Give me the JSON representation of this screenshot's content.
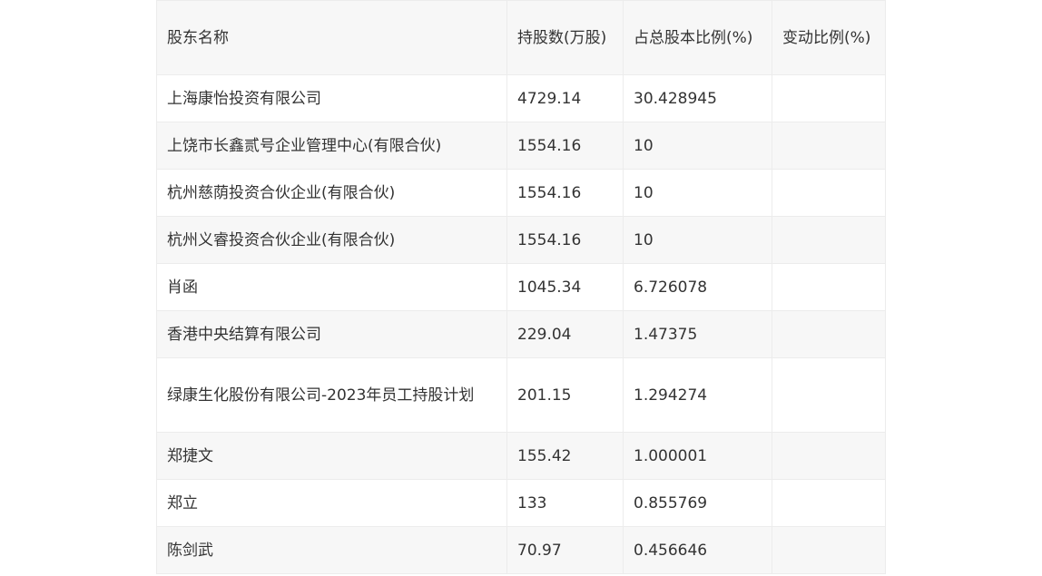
{
  "table": {
    "headers": [
      "股东名称",
      "持股数(万股)",
      "占总股本比例(%)",
      "变动比例(%)"
    ],
    "rows": [
      {
        "name": "上海康怡投资有限公司",
        "shares": "4729.14",
        "ratio": "30.428945",
        "change": ""
      },
      {
        "name": "上饶市长鑫贰号企业管理中心(有限合伙)",
        "shares": "1554.16",
        "ratio": "10",
        "change": ""
      },
      {
        "name": "杭州慈荫投资合伙企业(有限合伙)",
        "shares": "1554.16",
        "ratio": "10",
        "change": ""
      },
      {
        "name": "杭州义睿投资合伙企业(有限合伙)",
        "shares": "1554.16",
        "ratio": "10",
        "change": ""
      },
      {
        "name": "肖函",
        "shares": "1045.34",
        "ratio": "6.726078",
        "change": ""
      },
      {
        "name": "香港中央结算有限公司",
        "shares": "229.04",
        "ratio": "1.47375",
        "change": ""
      },
      {
        "name": "绿康生化股份有限公司-2023年员工持股计划",
        "shares": "201.15",
        "ratio": "1.294274",
        "change": ""
      },
      {
        "name": "郑捷文",
        "shares": "155.42",
        "ratio": "1.000001",
        "change": ""
      },
      {
        "name": "郑立",
        "shares": "133",
        "ratio": "0.855769",
        "change": ""
      },
      {
        "name": "陈剑武",
        "shares": "70.97",
        "ratio": "0.456646",
        "change": ""
      }
    ]
  }
}
